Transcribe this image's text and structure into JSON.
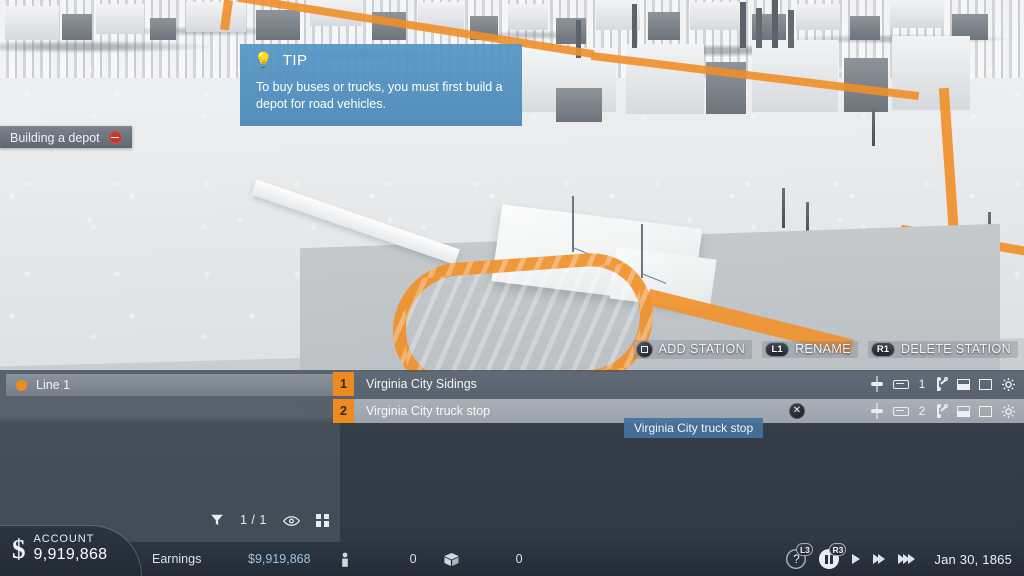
{
  "scene": {
    "description": "Snowy grayscale city with orange road loop and white depot platform"
  },
  "tip": {
    "icon": "lightbulb-icon",
    "title": "TIP",
    "body": "To buy buses or trucks, you must first build a depot for road vehicles."
  },
  "depot_badge": {
    "label": "Building a depot",
    "icon": "minus-circle-icon"
  },
  "prompts": [
    {
      "button": "square-button-icon",
      "label": "ADD STATION"
    },
    {
      "button": "L1",
      "label": "RENAME"
    },
    {
      "button": "R1",
      "label": "DELETE STATION"
    }
  ],
  "panel": {
    "line": {
      "label": "Line 1",
      "color": "#f08a1e",
      "dot_icon": "line-color-dot"
    },
    "stations": [
      {
        "number": "1",
        "name": "Virginia City Sidings",
        "stop_icon": "stop-marker-icon",
        "platform_icon": "platform-icon",
        "vehicle_count": "1",
        "branch_icon": "branch-switch-icon",
        "half_rect_icon": "load-partial-icon",
        "empty_rect_icon": "load-empty-icon",
        "gear_icon": "gear-icon",
        "selected": false,
        "has_close": false
      },
      {
        "number": "2",
        "name": "Virginia City truck stop",
        "stop_icon": "stop-marker-icon",
        "platform_icon": "platform-icon",
        "vehicle_count": "2",
        "branch_icon": "branch-switch-icon",
        "half_rect_icon": "load-partial-icon",
        "empty_rect_icon": "load-empty-icon",
        "gear_icon": "gear-icon",
        "selected": true,
        "has_close": true,
        "close_icon": "close-circle-icon"
      }
    ],
    "tooltip": "Virginia City truck stop",
    "tools": {
      "filter_icon": "filter-funnel-icon",
      "count": "1 / 1",
      "visibility_icon": "eye-icon",
      "grid_icon": "grid-view-icon"
    }
  },
  "status_bar": {
    "account": {
      "currency_symbol": "$",
      "label": "ACCOUNT",
      "value": "9,919,868"
    },
    "earnings": {
      "label": "Earnings",
      "value": "$9,919,868"
    },
    "stats": [
      {
        "icon": "passenger-icon",
        "value": "0"
      },
      {
        "icon": "cargo-box-icon",
        "value": "0"
      }
    ],
    "controls": {
      "help_icon": "question-mark-icon",
      "help_badge": "L3",
      "pause_icon": "pause-icon",
      "pause_badge": "R3",
      "play_icon": "play-icon",
      "fast_forward_icon": "fast-forward-icon",
      "very_fast_forward_icon": "very-fast-forward-icon"
    },
    "date": "Jan 30, 1865"
  }
}
